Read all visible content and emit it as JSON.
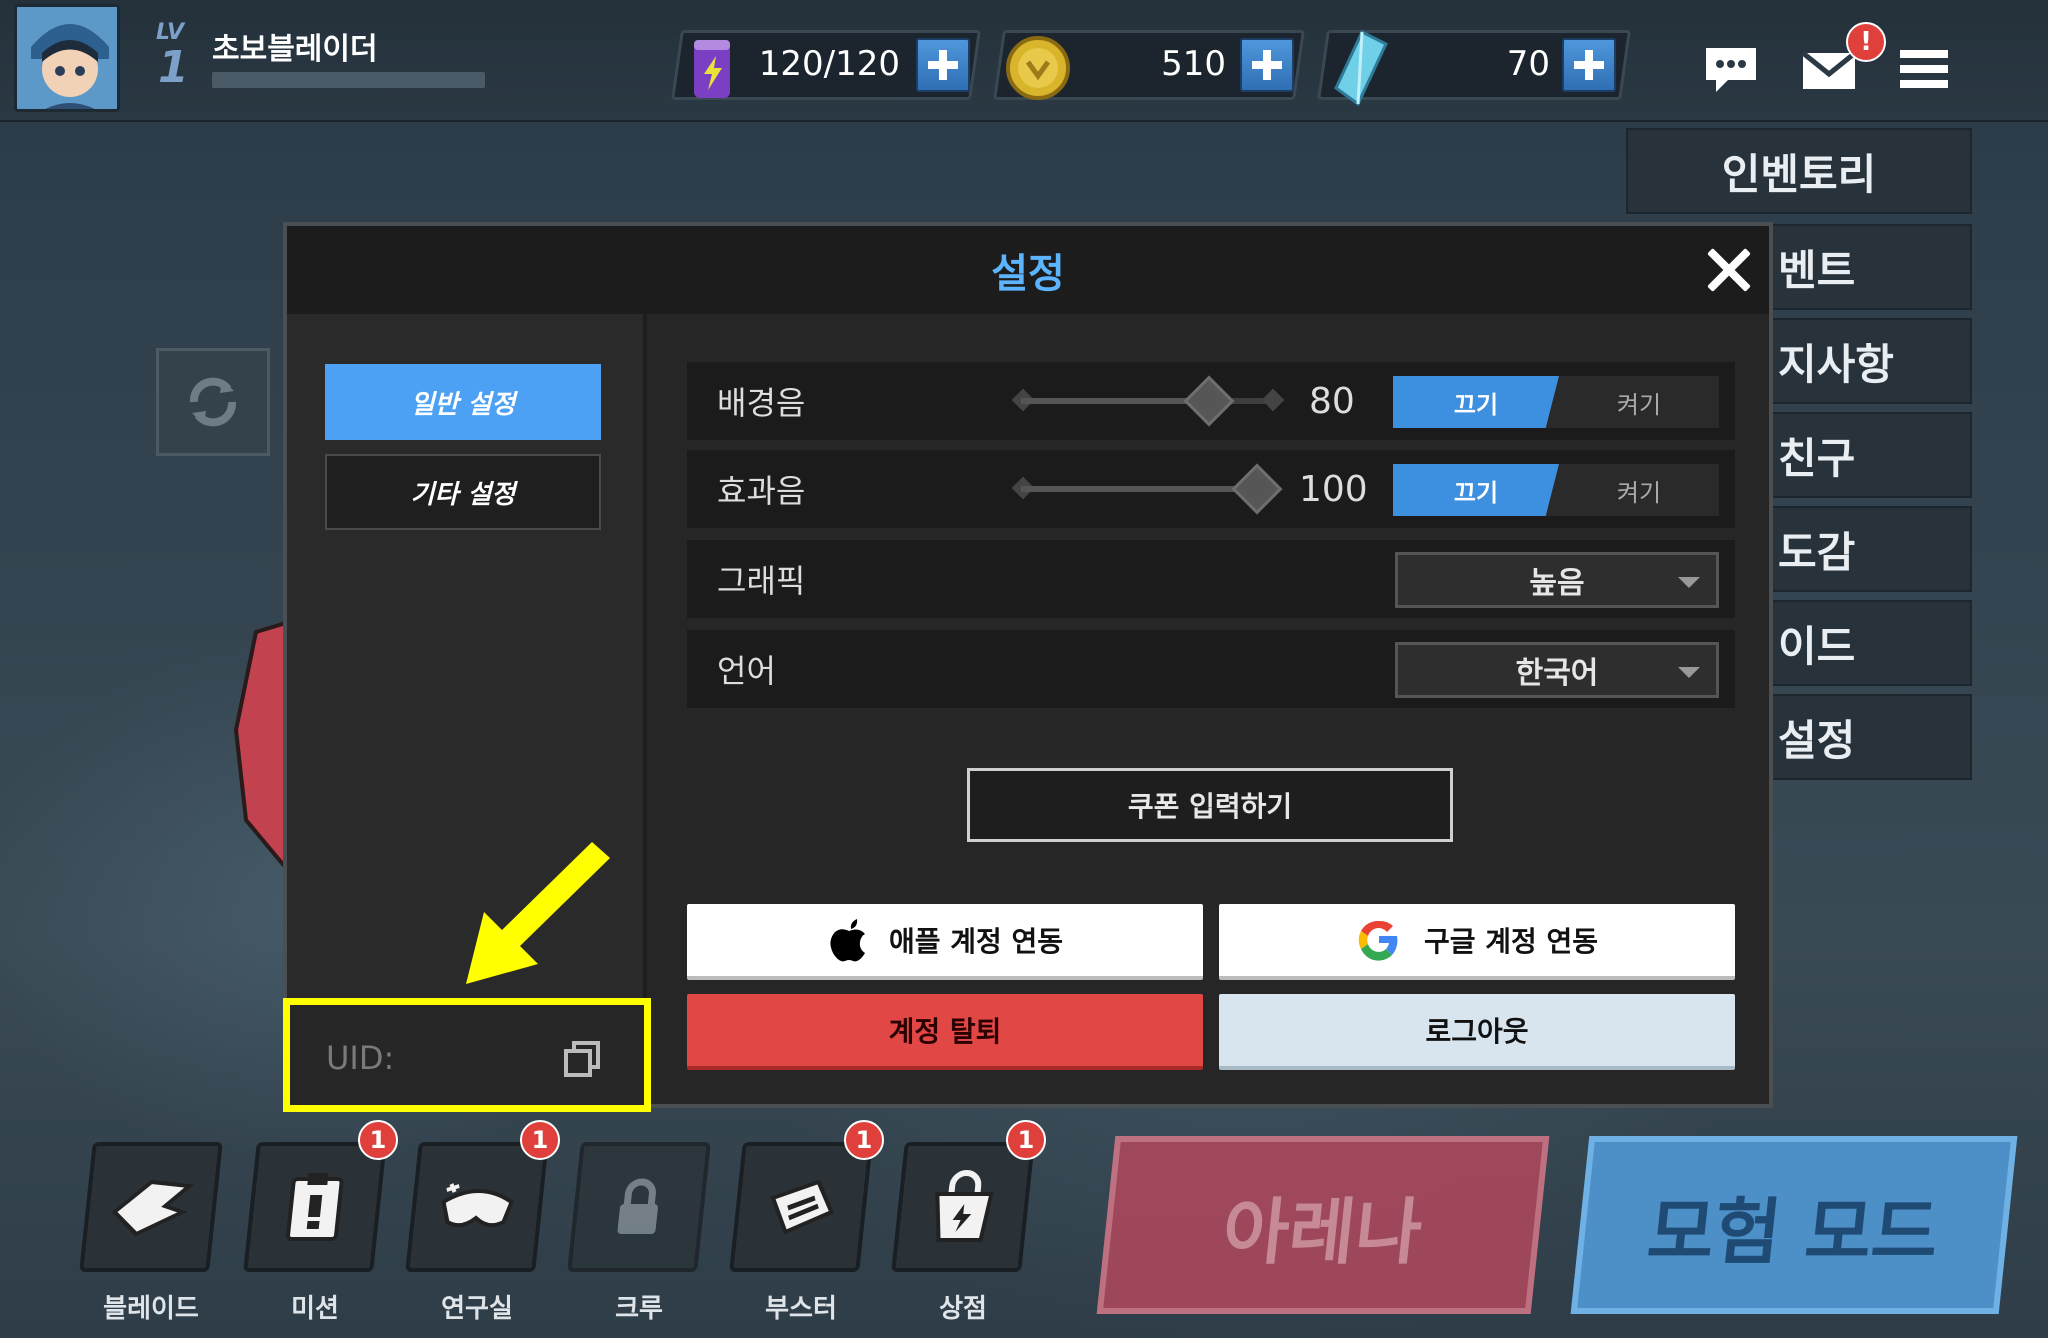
{
  "top_bar": {
    "level_label": "LV",
    "level": "1",
    "nickname": "초보블레이더",
    "energy": "120/120",
    "gold": "510",
    "gems": "70",
    "mail_badge": "!"
  },
  "side_menu": {
    "items": [
      "인벤토리",
      "벤트",
      "지사항",
      "친구",
      "도감",
      "이드",
      "설정"
    ]
  },
  "settings": {
    "title": "설정",
    "tabs": [
      "일반 설정",
      "기타 설정"
    ],
    "bgm": {
      "label": "배경음",
      "value": "80",
      "level": 0.8,
      "on_label": "끄기",
      "off_label": "켜기"
    },
    "sfx": {
      "label": "효과음",
      "value": "100",
      "level": 1.0,
      "on_label": "끄기",
      "off_label": "켜기"
    },
    "graphics": {
      "label": "그래픽",
      "selected": "높음"
    },
    "language": {
      "label": "언어",
      "selected": "한국어"
    },
    "coupon_label": "쿠폰 입력하기",
    "apple_label": "애플 계정 연동",
    "google_label": "구글 계정 연동",
    "delete_label": "계정 탈퇴",
    "logout_label": "로그아웃",
    "uid_label": "UID:"
  },
  "bottom_nav": {
    "items": [
      {
        "label": "블레이드",
        "badge": ""
      },
      {
        "label": "미션",
        "badge": "1"
      },
      {
        "label": "연구실",
        "badge": "1"
      },
      {
        "label": "크루",
        "badge": ""
      },
      {
        "label": "부스터",
        "badge": "1"
      },
      {
        "label": "상점",
        "badge": "1"
      }
    ],
    "arena_label": "아레나",
    "adventure_label": "모험 모드"
  },
  "colors": {
    "accent": "#4da1f5",
    "highlight": "#ffff00",
    "danger": "#e14744"
  }
}
